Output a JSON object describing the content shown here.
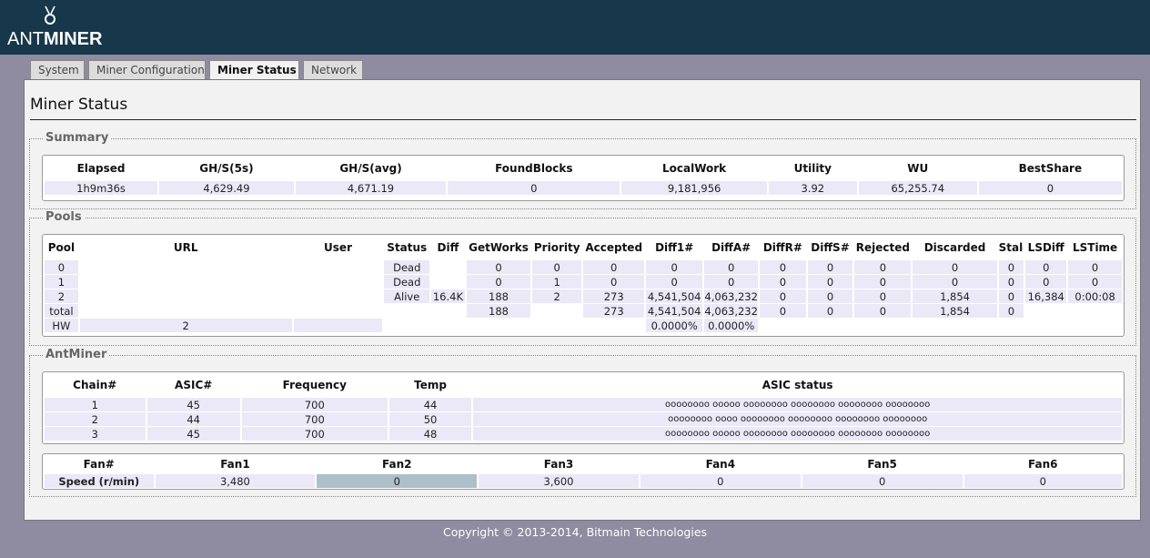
{
  "brand": {
    "prefix": "ANT",
    "suffix": "MINER"
  },
  "tabs": [
    {
      "label": "System",
      "active": false
    },
    {
      "label": "Miner Configuration",
      "active": false
    },
    {
      "label": "Miner Status",
      "active": true
    },
    {
      "label": "Network",
      "active": false
    }
  ],
  "page_title": "Miner Status",
  "summary": {
    "legend": "Summary",
    "headers": [
      "Elapsed",
      "GH/S(5s)",
      "GH/S(avg)",
      "FoundBlocks",
      "LocalWork",
      "Utility",
      "WU",
      "BestShare"
    ],
    "row": [
      "1h9m36s",
      "4,629.49",
      "4,671.19",
      "0",
      "9,181,956",
      "3.92",
      "65,255.74",
      "0"
    ]
  },
  "pools": {
    "legend": "Pools",
    "headers": [
      "Pool",
      "URL",
      "User",
      "Status",
      "Diff",
      "GetWorks",
      "Priority",
      "Accepted",
      "Diff1#",
      "DiffA#",
      "DiffR#",
      "DiffS#",
      "Rejected",
      "Discarded",
      "Stale",
      "LSDiff",
      "LSTime"
    ],
    "rows": [
      [
        "0",
        "",
        "",
        "Dead",
        "",
        "0",
        "0",
        "0",
        "0",
        "0",
        "0",
        "0",
        "0",
        "0",
        "0",
        "0",
        "0"
      ],
      [
        "1",
        "",
        "",
        "Dead",
        "",
        "0",
        "1",
        "0",
        "0",
        "0",
        "0",
        "0",
        "0",
        "0",
        "0",
        "0",
        "0"
      ],
      [
        "2",
        "",
        "",
        "Alive",
        "16.4K",
        "188",
        "2",
        "273",
        "4,541,504",
        "4,063,232",
        "0",
        "0",
        "0",
        "1,854",
        "0",
        "16,384",
        "0:00:08"
      ],
      [
        "total",
        "",
        "",
        "",
        "",
        "188",
        "",
        "273",
        "4,541,504",
        "4,063,232",
        "0",
        "0",
        "0",
        "1,854",
        "0",
        "",
        ""
      ]
    ],
    "hw_row": {
      "label": "HW",
      "value": "2",
      "diff1_pct": "0.0000%",
      "diffa_pct": "0.0000%"
    }
  },
  "antminer": {
    "legend": "AntMiner",
    "chain_headers": [
      "Chain#",
      "ASIC#",
      "Frequency",
      "Temp",
      "ASIC status"
    ],
    "chains": [
      [
        "1",
        "45",
        "700",
        "44",
        "oooooooo ooooo oooooooo oooooooo oooooooo oooooooo"
      ],
      [
        "2",
        "44",
        "700",
        "50",
        "oooooooo oooo oooooooo oooooooo oooooooo oooooooo"
      ],
      [
        "3",
        "45",
        "700",
        "48",
        "oooooooo ooooo oooooooo oooooooo oooooooo oooooooo"
      ]
    ],
    "fan_headers": [
      "Fan#",
      "Fan1",
      "Fan2",
      "Fan3",
      "Fan4",
      "Fan5",
      "Fan6"
    ],
    "fan_row_label": "Speed (r/min)",
    "fan_speeds": [
      "3,480",
      "0",
      "3,600",
      "0",
      "0",
      "0"
    ]
  },
  "footer": "Copyright © 2013-2014, Bitmain Technologies",
  "colors": {
    "header_bg": "#17384b",
    "page_bg": "#8f8ba0",
    "cell_bg": "#ebe8f7",
    "highlight_cell": "#adbfc8"
  }
}
